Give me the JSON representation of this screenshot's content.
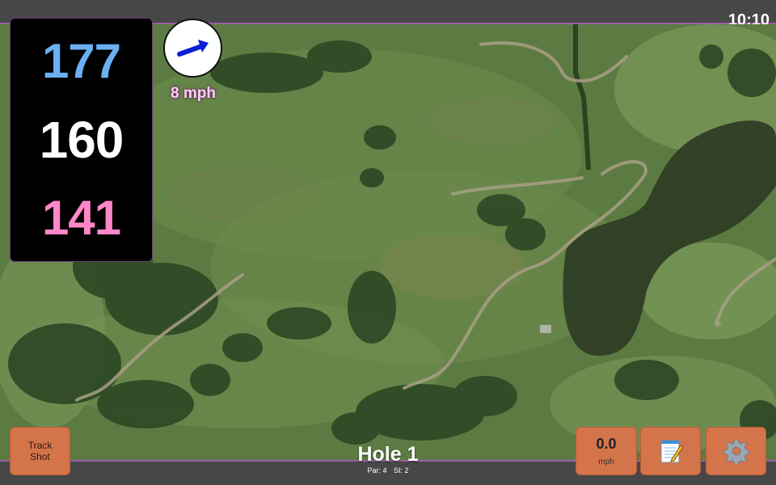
{
  "status_bar": {
    "time": "10:10"
  },
  "distances": {
    "back": "177",
    "middle": "160",
    "front": "141"
  },
  "wind": {
    "speed": "8 mph",
    "icon": "wind-direction-arrow-icon"
  },
  "hole": {
    "title": "Hole 1",
    "par": "Par: 4",
    "si": "SI: 2"
  },
  "buttons": {
    "track_shot": "Track Shot",
    "speed_value": "0.0",
    "speed_unit": "mph",
    "notes_icon": "notepad-icon",
    "settings_icon": "gear-icon"
  },
  "colors": {
    "back": "#6ab0f3",
    "middle": "#ffffff",
    "front": "#ff87c8",
    "button": "#d4744a",
    "accent_line": "#9b5fa6"
  }
}
